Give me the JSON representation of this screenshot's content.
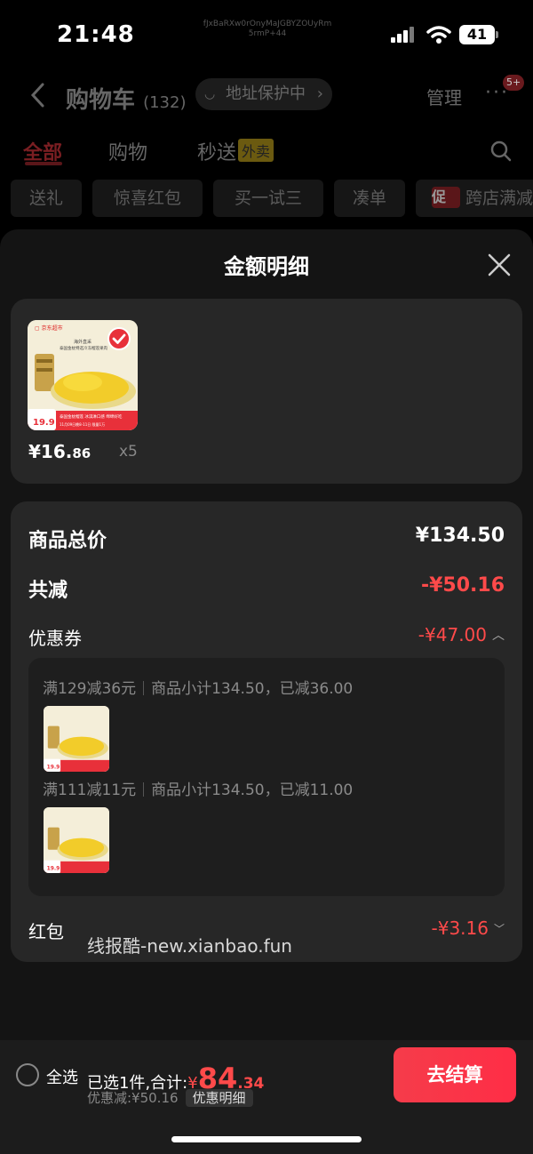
{
  "status": {
    "time": "21:48",
    "battery": "41",
    "overlay_code": "fJxBaRXw0rOnyMaJGBYZOUyRm5rmP+44"
  },
  "header": {
    "title": "购物车",
    "count": "(132)",
    "address_protect": "地址保护中",
    "manage": "管理",
    "badge": "5+"
  },
  "tabs": [
    {
      "label": "全部"
    },
    {
      "label": "购物"
    },
    {
      "label": "秒送",
      "tag": "外卖"
    }
  ],
  "chips": [
    "送礼",
    "惊喜红包",
    "买一试三",
    "凑单",
    "跨店满减"
  ],
  "chip_tag": "促",
  "sheet": {
    "title": "金额明细",
    "product": {
      "price_int": "¥16.",
      "price_dec": "86",
      "qty": "x5",
      "image_texts": {
        "brand": "京东超市",
        "line1": "海外直采",
        "line2": "泰国金枕特选冷冻榴莲果肉",
        "promo": "泰国金枕榴莲 冰淇淋口感 绵绵好吃",
        "price": "19.9",
        "date": "11月09日晚8-11日 限量1万 售完即止"
      }
    },
    "total_label": "商品总价",
    "total_value": "¥134.50",
    "reduce_label": "共减",
    "reduce_value": "-¥50.16",
    "coupon_label": "优惠券",
    "coupon_value": "-¥47.00",
    "coupon_rules": [
      {
        "rule": "满129减36元",
        "detail": "商品小计134.50，已减36.00"
      },
      {
        "rule": "满111减11元",
        "detail": "商品小计134.50，已减11.00"
      }
    ],
    "hongbao_label": "红包",
    "hongbao_value": "-¥3.16",
    "watermark": "线报酷-new.xianbao.fun"
  },
  "bottom": {
    "select_all": "全选",
    "selected": "已选1件,合计:",
    "sum_symbol": "¥",
    "sum_int": "84",
    "sum_dec": ".34",
    "discount": "优惠减:¥50.16",
    "detail_btn": "优惠明细",
    "checkout": "去结算"
  },
  "colors": {
    "accent": "#ff2d46",
    "background": "#000000",
    "sheet": "#141414",
    "card": "#272727"
  }
}
